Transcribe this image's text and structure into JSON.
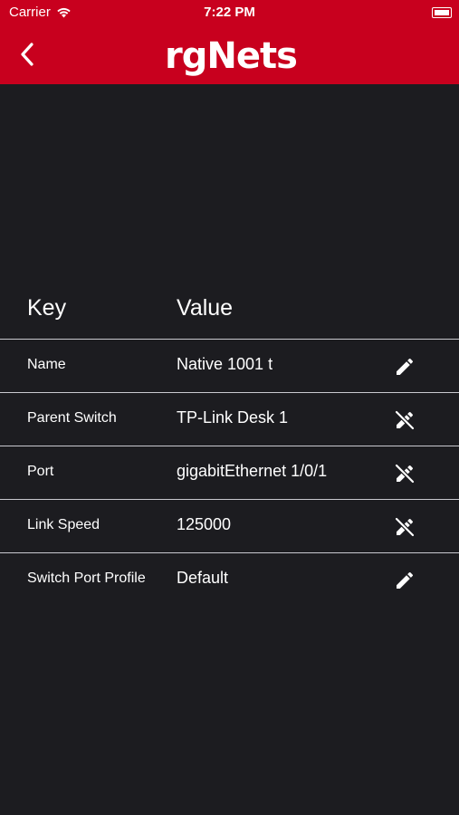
{
  "status_bar": {
    "carrier": "Carrier",
    "time": "7:22 PM",
    "wifi_icon": "wifi-icon",
    "battery_icon": "battery-icon"
  },
  "header": {
    "logo_text": "rgNets",
    "back_icon": "chevron-left-icon",
    "background_color": "#c8001e"
  },
  "table": {
    "key_header": "Key",
    "value_header": "Value",
    "rows": [
      {
        "key": "Name",
        "value": "Native 1001 t",
        "action_icon": "pencil-icon"
      },
      {
        "key": "Parent Switch",
        "value": "TP-Link Desk 1",
        "action_icon": "edit-off-icon"
      },
      {
        "key": "Port",
        "value": "gigabitEthernet 1/0/1",
        "action_icon": "edit-off-icon"
      },
      {
        "key": "Link Speed",
        "value": "125000",
        "action_icon": "edit-off-icon"
      },
      {
        "key": "Switch Port Profile",
        "value": "Default",
        "action_icon": "pencil-icon"
      }
    ]
  },
  "colors": {
    "background": "#1c1c20",
    "divider": "#c9c9cf",
    "text": "#ffffff"
  }
}
